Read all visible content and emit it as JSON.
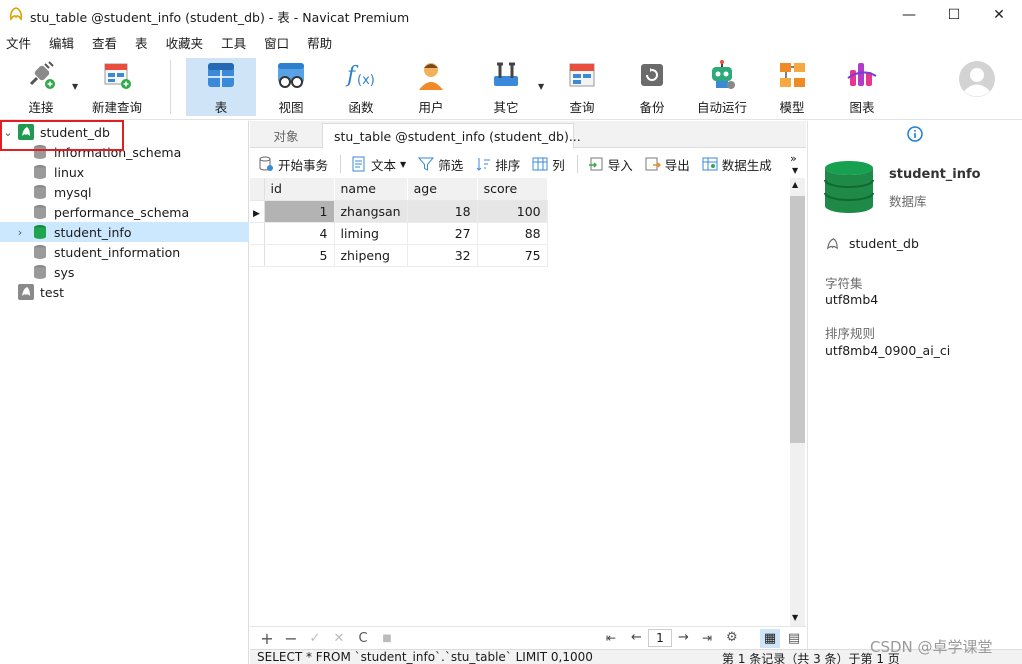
{
  "window": {
    "title": "stu_table @student_info (student_db) - 表 - Navicat Premium",
    "minimize": "—",
    "maximize": "☐",
    "close": "✕"
  },
  "menu": [
    "文件",
    "编辑",
    "查看",
    "表",
    "收藏夹",
    "工具",
    "窗口",
    "帮助"
  ],
  "toolbar": {
    "connect": "连接",
    "new_query": "新建查询",
    "table": "表",
    "view": "视图",
    "function": "函数",
    "user": "用户",
    "other": "其它",
    "query": "查询",
    "backup": "备份",
    "automation": "自动运行",
    "model": "模型",
    "chart": "图表"
  },
  "tree": {
    "connection": "student_db",
    "databases": [
      "information_schema",
      "linux",
      "mysql",
      "performance_schema",
      "student_info",
      "student_information",
      "sys"
    ],
    "other_connection": "test",
    "selected": "student_info"
  },
  "tabs": {
    "objects": "对象",
    "active": "stu_table @student_info (student_db)..."
  },
  "data_toolbar": {
    "begin_transaction": "开始事务",
    "text": "文本",
    "filter": "筛选",
    "sort": "排序",
    "columns": "列",
    "import": "导入",
    "export": "导出",
    "generate": "数据生成"
  },
  "grid": {
    "columns": [
      "id",
      "name",
      "age",
      "score"
    ],
    "rows": [
      {
        "id": "1",
        "name": "zhangsan",
        "age": "18",
        "score": "100"
      },
      {
        "id": "4",
        "name": "liming",
        "age": "27",
        "score": "88"
      },
      {
        "id": "5",
        "name": "zhipeng",
        "age": "32",
        "score": "75"
      }
    ]
  },
  "footer": {
    "add": "+",
    "remove": "−",
    "apply": "✓",
    "discard": "✕",
    "refresh": "C",
    "stop": "■",
    "page": "1"
  },
  "status": {
    "sql": "SELECT * FROM `student_info`.`stu_table` LIMIT 0,1000",
    "record": "第 1 条记录（共 3 条）于第 1 页"
  },
  "info_panel": {
    "name": "student_info",
    "type": "数据库",
    "connection": "student_db",
    "charset_label": "字符集",
    "charset": "utf8mb4",
    "collation_label": "排序规则",
    "collation": "utf8mb4_0900_ai_ci"
  },
  "watermark": "CSDN @卓学课堂",
  "colors": {
    "accent": "#1a7fd6",
    "selection": "#cce8ff",
    "db_green": "#1f9a4f",
    "highlight_box": "#e02020"
  }
}
